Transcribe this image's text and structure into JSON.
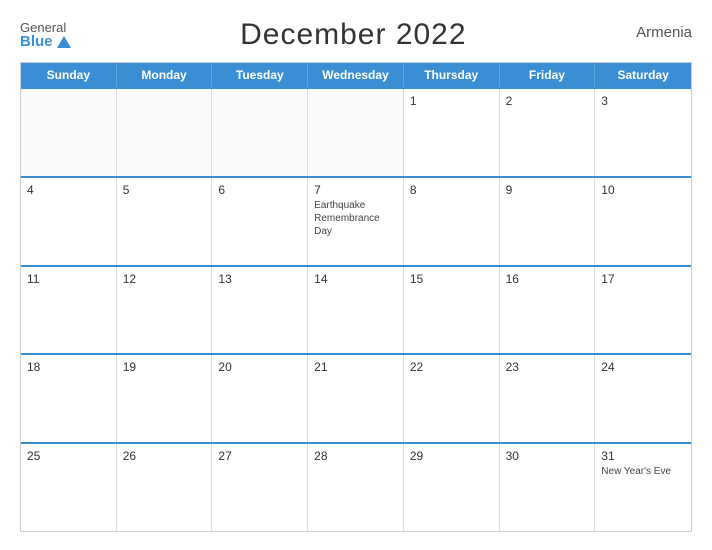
{
  "header": {
    "logo_general": "General",
    "logo_blue": "Blue",
    "title": "December 2022",
    "country": "Armenia"
  },
  "weekdays": [
    "Sunday",
    "Monday",
    "Tuesday",
    "Wednesday",
    "Thursday",
    "Friday",
    "Saturday"
  ],
  "weeks": [
    [
      {
        "day": "",
        "empty": true
      },
      {
        "day": "",
        "empty": true
      },
      {
        "day": "",
        "empty": true
      },
      {
        "day": "",
        "empty": true
      },
      {
        "day": "1",
        "empty": false,
        "event": ""
      },
      {
        "day": "2",
        "empty": false,
        "event": ""
      },
      {
        "day": "3",
        "empty": false,
        "event": ""
      }
    ],
    [
      {
        "day": "4",
        "empty": false,
        "event": ""
      },
      {
        "day": "5",
        "empty": false,
        "event": ""
      },
      {
        "day": "6",
        "empty": false,
        "event": ""
      },
      {
        "day": "7",
        "empty": false,
        "event": "Earthquake Remembrance Day"
      },
      {
        "day": "8",
        "empty": false,
        "event": ""
      },
      {
        "day": "9",
        "empty": false,
        "event": ""
      },
      {
        "day": "10",
        "empty": false,
        "event": ""
      }
    ],
    [
      {
        "day": "11",
        "empty": false,
        "event": ""
      },
      {
        "day": "12",
        "empty": false,
        "event": ""
      },
      {
        "day": "13",
        "empty": false,
        "event": ""
      },
      {
        "day": "14",
        "empty": false,
        "event": ""
      },
      {
        "day": "15",
        "empty": false,
        "event": ""
      },
      {
        "day": "16",
        "empty": false,
        "event": ""
      },
      {
        "day": "17",
        "empty": false,
        "event": ""
      }
    ],
    [
      {
        "day": "18",
        "empty": false,
        "event": ""
      },
      {
        "day": "19",
        "empty": false,
        "event": ""
      },
      {
        "day": "20",
        "empty": false,
        "event": ""
      },
      {
        "day": "21",
        "empty": false,
        "event": ""
      },
      {
        "day": "22",
        "empty": false,
        "event": ""
      },
      {
        "day": "23",
        "empty": false,
        "event": ""
      },
      {
        "day": "24",
        "empty": false,
        "event": ""
      }
    ],
    [
      {
        "day": "25",
        "empty": false,
        "event": ""
      },
      {
        "day": "26",
        "empty": false,
        "event": ""
      },
      {
        "day": "27",
        "empty": false,
        "event": ""
      },
      {
        "day": "28",
        "empty": false,
        "event": ""
      },
      {
        "day": "29",
        "empty": false,
        "event": ""
      },
      {
        "day": "30",
        "empty": false,
        "event": ""
      },
      {
        "day": "31",
        "empty": false,
        "event": "New Year's Eve"
      }
    ]
  ],
  "colors": {
    "header_bg": "#3a8fd4",
    "accent": "#3a8fd4"
  }
}
